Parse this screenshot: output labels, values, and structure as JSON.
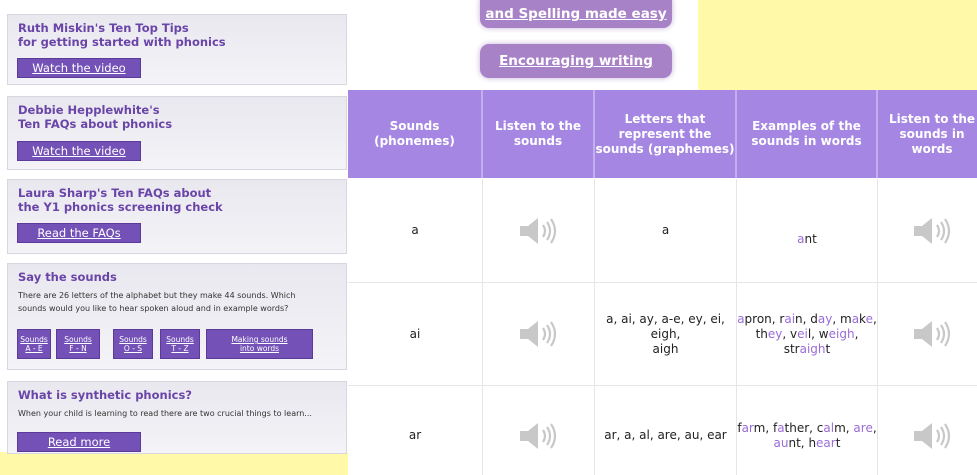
{
  "sidebar": {
    "cards": [
      {
        "title_lines": [
          "Ruth Miskin's Ten Top Tips",
          "for getting started with phonics"
        ],
        "button": "Watch the video"
      },
      {
        "title_lines": [
          "Debbie Hepplewhite's",
          "Ten FAQs about phonics"
        ],
        "button": "Watch the video"
      },
      {
        "title_lines": [
          "Laura Sharp's Ten FAQs about",
          "the Y1 phonics screening check"
        ],
        "button": "Read the FAQs"
      }
    ],
    "say_sounds": {
      "title": "Say the sounds",
      "text_line1": "There are 26 letters of the alphabet but they make 44 sounds. Which",
      "text_line2": "sounds would you like to hear spoken aloud and in example words?",
      "buttons": [
        {
          "line1": "Sounds",
          "line2": "A - E"
        },
        {
          "line1": "Sounds",
          "line2": "F - N"
        },
        {
          "line1": "Sounds",
          "line2": "O - S"
        },
        {
          "line1": "Sounds",
          "line2": "T - Z"
        },
        {
          "line1": "Making sounds",
          "line2": "into words"
        }
      ]
    },
    "synthetic": {
      "title": "What is synthetic phonics?",
      "text": "When your child is learning to read there are two crucial things to learn...",
      "button": "Read more"
    }
  },
  "top_buttons": {
    "spelling": "and Spelling made easy",
    "writing": "Encouraging writing"
  },
  "table": {
    "headers": [
      [
        "Sounds",
        "(phonemes)"
      ],
      [
        "Listen to the",
        "sounds"
      ],
      [
        "Letters that",
        "represent the",
        "sounds (graphemes)"
      ],
      [
        "Examples of the",
        "sounds in words"
      ],
      [
        "Listen to the",
        "sounds in words"
      ]
    ],
    "rows": [
      {
        "sound": "a",
        "graphemes": [
          "a"
        ],
        "examples": [
          [
            {
              "t": "a",
              "h": true
            },
            {
              "t": "nt",
              "h": false
            }
          ]
        ]
      },
      {
        "sound": "ai",
        "graphemes": [
          "a, ai, ay, a-e, ey, ei, eigh,",
          "aigh"
        ],
        "examples": [
          [
            {
              "t": "a",
              "h": true
            },
            {
              "t": "pron, r",
              "h": false
            },
            {
              "t": "ai",
              "h": true
            },
            {
              "t": "n, d",
              "h": false
            },
            {
              "t": "ay",
              "h": true
            },
            {
              "t": ", m",
              "h": false
            },
            {
              "t": "a",
              "h": true
            },
            {
              "t": "k",
              "h": false
            },
            {
              "t": "e",
              "h": true
            },
            {
              "t": ",",
              "h": false
            }
          ],
          [
            {
              "t": "th",
              "h": false
            },
            {
              "t": "ey",
              "h": true
            },
            {
              "t": ", v",
              "h": false
            },
            {
              "t": "ei",
              "h": true
            },
            {
              "t": "l, w",
              "h": false
            },
            {
              "t": "eigh",
              "h": true
            },
            {
              "t": ",",
              "h": false
            }
          ],
          [
            {
              "t": "str",
              "h": false
            },
            {
              "t": "aigh",
              "h": true
            },
            {
              "t": "t",
              "h": false
            }
          ]
        ]
      },
      {
        "sound": "ar",
        "graphemes": [
          "ar, a, al, are, au, ear"
        ],
        "examples": [
          [
            {
              "t": "f",
              "h": false
            },
            {
              "t": "ar",
              "h": true
            },
            {
              "t": "m, f",
              "h": false
            },
            {
              "t": "a",
              "h": true
            },
            {
              "t": "ther, c",
              "h": false
            },
            {
              "t": "al",
              "h": true
            },
            {
              "t": "m, ",
              "h": false
            },
            {
              "t": "are",
              "h": true
            },
            {
              "t": ",",
              "h": false
            }
          ],
          [
            {
              "t": "au",
              "h": true
            },
            {
              "t": "nt, h",
              "h": false
            },
            {
              "t": "ear",
              "h": true
            },
            {
              "t": "t",
              "h": false
            }
          ]
        ]
      }
    ]
  }
}
